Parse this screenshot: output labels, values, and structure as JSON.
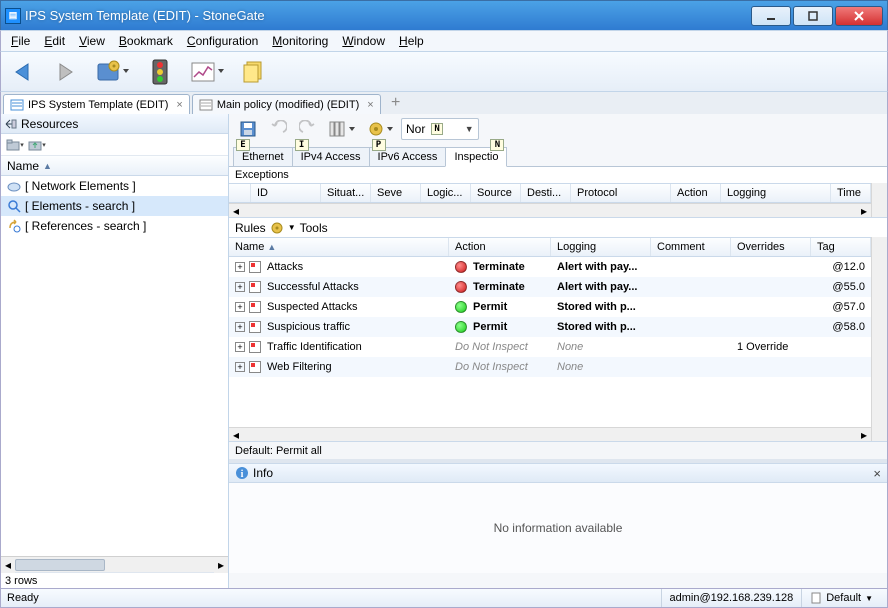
{
  "window": {
    "title": "IPS System Template (EDIT) - StoneGate"
  },
  "menu": [
    "File",
    "Edit",
    "View",
    "Bookmark",
    "Configuration",
    "Monitoring",
    "Window",
    "Help"
  ],
  "doc_tabs": [
    {
      "label": "IPS System Template (EDIT)",
      "active": true
    },
    {
      "label": "Main policy (modified) (EDIT)",
      "active": false
    }
  ],
  "left_pane": {
    "title": "Resources",
    "column": "Name",
    "rows": [
      "[ Network Elements ]",
      "[ Elements - search ]",
      "[ References - search ]"
    ],
    "row_count": "3 rows"
  },
  "right_pane": {
    "norm_dropdown": "Nor",
    "tabs": [
      {
        "label": "Ethernet",
        "badge": "E"
      },
      {
        "label": "IPv4 Access",
        "badge": "I"
      },
      {
        "label": "IPv6 Access",
        "badge": "P"
      },
      {
        "label": "Inspectio",
        "badge": "N",
        "active": true
      }
    ],
    "exceptions": {
      "label": "Exceptions",
      "columns": [
        "ID",
        "Situat...",
        "Seve",
        "Logic...",
        "Source",
        "Desti...",
        "Protocol",
        "Action",
        "Logging",
        "Time"
      ]
    },
    "rules_toolbar": {
      "label": "Rules",
      "tools_label": "Tools"
    },
    "rules": {
      "columns": [
        "Name",
        "Action",
        "Logging",
        "Comment",
        "Overrides",
        "Tag"
      ],
      "rows": [
        {
          "name": "Attacks",
          "action": "Terminate",
          "action_style": "red bold",
          "logging": "Alert with pay...",
          "logging_style": "bold",
          "overrides": "",
          "tag": "@12.0"
        },
        {
          "name": "Successful Attacks",
          "action": "Terminate",
          "action_style": "red bold",
          "logging": "Alert with pay...",
          "logging_style": "bold",
          "overrides": "",
          "tag": "@55.0"
        },
        {
          "name": "Suspected Attacks",
          "action": "Permit",
          "action_style": "green bold",
          "logging": "Stored with p...",
          "logging_style": "bold",
          "overrides": "",
          "tag": "@57.0"
        },
        {
          "name": "Suspicious traffic",
          "action": "Permit",
          "action_style": "green bold",
          "logging": "Stored with p...",
          "logging_style": "bold",
          "overrides": "",
          "tag": "@58.0"
        },
        {
          "name": "Traffic Identification",
          "action": "Do Not Inspect",
          "action_style": "muted",
          "logging": "None",
          "logging_style": "muted",
          "overrides": "1 Override",
          "tag": ""
        },
        {
          "name": "Web Filtering",
          "action": "Do Not Inspect",
          "action_style": "muted",
          "logging": "None",
          "logging_style": "muted",
          "overrides": "",
          "tag": ""
        }
      ]
    },
    "default_row": "Default: Permit all",
    "info": {
      "title": "Info",
      "body": "No information available"
    }
  },
  "status": {
    "ready": "Ready",
    "user": "admin@192.168.239.128",
    "mode": "Default"
  }
}
